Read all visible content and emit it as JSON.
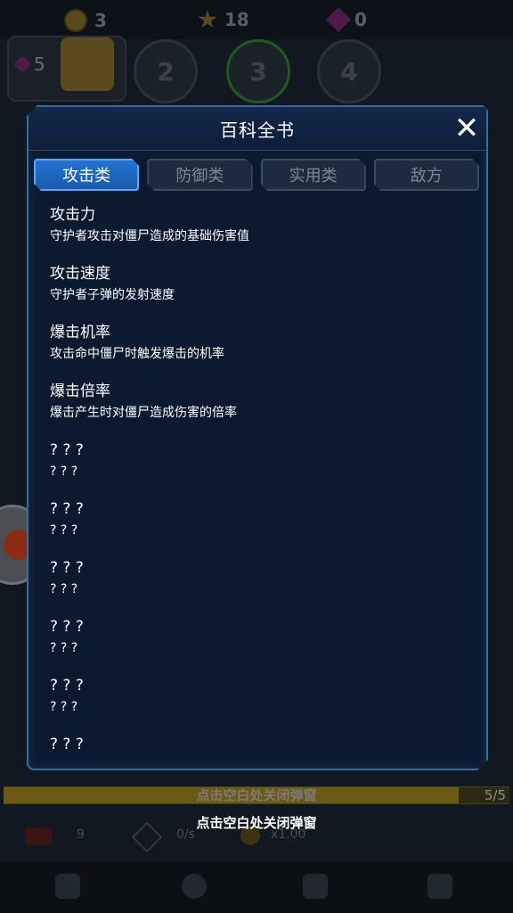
{
  "hud": {
    "coins": "3",
    "stars": "18",
    "gems": "0",
    "gem_box_count": "5",
    "levels": [
      "2",
      "3",
      "4"
    ]
  },
  "modal": {
    "title": "百科全书",
    "close_icon": "close-icon",
    "tabs": [
      {
        "label": "攻击类",
        "active": true
      },
      {
        "label": "防御类",
        "active": false
      },
      {
        "label": "实用类",
        "active": false
      },
      {
        "label": "敌方",
        "active": false
      }
    ],
    "entries": [
      {
        "name": "攻击力",
        "desc": "守护者攻击对僵尸造成的基础伤害值"
      },
      {
        "name": "攻击速度",
        "desc": "守护者子弹的发射速度"
      },
      {
        "name": "爆击机率",
        "desc": "攻击命中僵尸时触发爆击的机率"
      },
      {
        "name": "爆击倍率",
        "desc": "爆击产生时对僵尸造成伤害的倍率"
      },
      {
        "name": "? ? ?",
        "desc": "? ? ?"
      },
      {
        "name": "? ? ?",
        "desc": "? ? ?"
      },
      {
        "name": "? ? ?",
        "desc": "? ? ?"
      },
      {
        "name": "? ? ?",
        "desc": "? ? ?"
      },
      {
        "name": "? ? ?",
        "desc": "? ? ?"
      },
      {
        "name": "? ? ?",
        "desc": ""
      }
    ]
  },
  "footer": {
    "progress_label": "点击空白处关闭弹窗",
    "progress_count": "5/5",
    "progress_fraction": 0.9,
    "close_hint": "点击空白处关闭弹窗",
    "stat_kills": "9",
    "stat_rate": "0/s",
    "stat_multiplier": "x1.00"
  }
}
